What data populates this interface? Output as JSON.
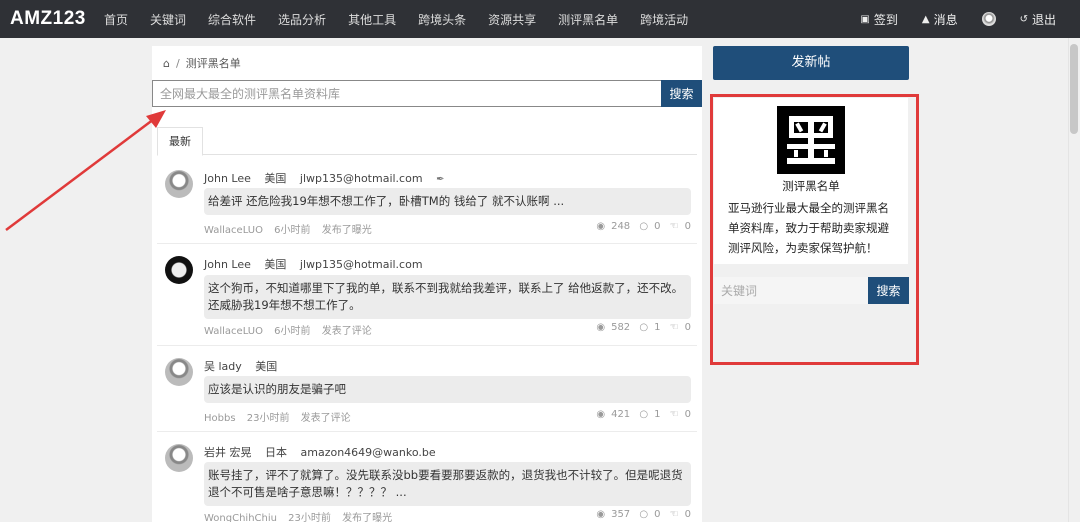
{
  "brand": {
    "logo": "AMZ123"
  },
  "nav": {
    "items": [
      {
        "label": "首页"
      },
      {
        "label": "关键词"
      },
      {
        "label": "综合软件"
      },
      {
        "label": "选品分析"
      },
      {
        "label": "其他工具"
      },
      {
        "label": "跨境头条"
      },
      {
        "label": "资源共享"
      },
      {
        "label": "测评黑名单"
      },
      {
        "label": "跨境活动"
      }
    ],
    "right": {
      "checkin": "签到",
      "messages": "消息",
      "logout": "退出"
    }
  },
  "breadcrumb": {
    "current": "测评黑名单"
  },
  "search": {
    "placeholder": "全网最大最全的测评黑名单资料库",
    "button": "搜索"
  },
  "tabs": {
    "active": "最新"
  },
  "posts": [
    {
      "author": "John Lee",
      "country": "美国",
      "email": "jlwp135@hotmail.com",
      "content": "给差评 还危险我19年想不想工作了，卧槽TM的    钱给了 就不认账啊 ...",
      "user": "WallaceLUO",
      "time": "6小时前",
      "action": "发布了曝光",
      "views": "248",
      "comments": "0",
      "likes": "0"
    },
    {
      "author": "John Lee",
      "country": "美国",
      "email": "jlwp135@hotmail.com",
      "content": "这个狗币，不知道哪里下了我的单，联系不到我就给我差评，联系上了 给他返款了，还不改。还威胁我19年想不想工作了。",
      "user": "WallaceLUO",
      "time": "6小时前",
      "action": "发表了评论",
      "views": "582",
      "comments": "1",
      "likes": "0"
    },
    {
      "author": "吴 lady",
      "country": "美国",
      "email": "",
      "content": "应该是认识的朋友是骗子吧",
      "user": "Hobbs",
      "time": "23小时前",
      "action": "发表了评论",
      "views": "421",
      "comments": "1",
      "likes": "0"
    },
    {
      "author": "岩井 宏晃",
      "country": "日本",
      "email": "amazon4649@wanko.be",
      "content": "账号挂了，评不了就算了。没先联系没bb要看要那要返款的，退货我也不计较了。但是呢退货退个不可售是啥子意思嘛！？？？？ ...",
      "user": "WongChihChiu",
      "time": "23小时前",
      "action": "发布了曝光",
      "views": "357",
      "comments": "0",
      "likes": "0"
    }
  ],
  "sidebar": {
    "new_post": "发新帖",
    "name": "测评黑名单",
    "description": "亚马逊行业最大最全的测评黑名单资料库，致力于帮助卖家规避测评风险，为卖家保驾护航！",
    "search_placeholder": "关键词",
    "search_button": "搜索"
  },
  "colors": {
    "nav_bg": "#2f3136",
    "accent": "#1f4e7a",
    "highlight": "#e03a3a"
  }
}
